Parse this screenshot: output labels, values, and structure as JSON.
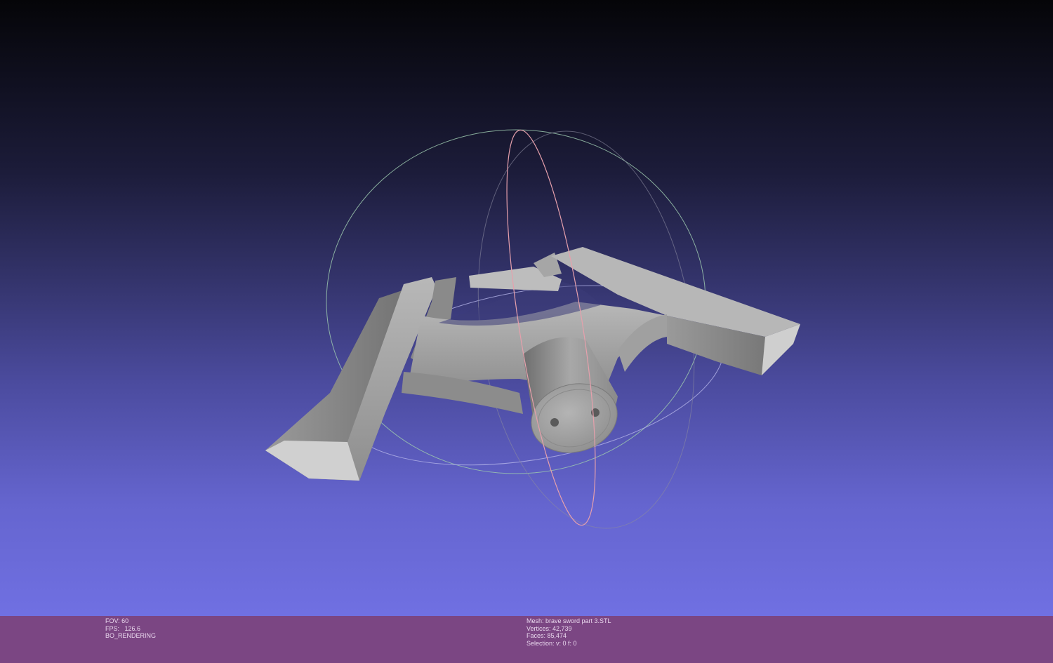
{
  "render_info": {
    "fov": "FOV: 60",
    "fps": "FPS:   126.6",
    "mode": "BO_RENDERING"
  },
  "mesh_info": {
    "mesh": "Mesh: brave sword part 3.STL",
    "vertices": "Vertices: 42,739",
    "faces": "Faces: 85,474",
    "selection": "Selection: v: 0 f: 0"
  },
  "colors": {
    "model": "#9a9a9a",
    "trackball_x": "#e6a0ac",
    "trackball_y": "#9cc8ae",
    "trackball_z": "#b4b4e8",
    "status_bar": "#7b4683"
  }
}
